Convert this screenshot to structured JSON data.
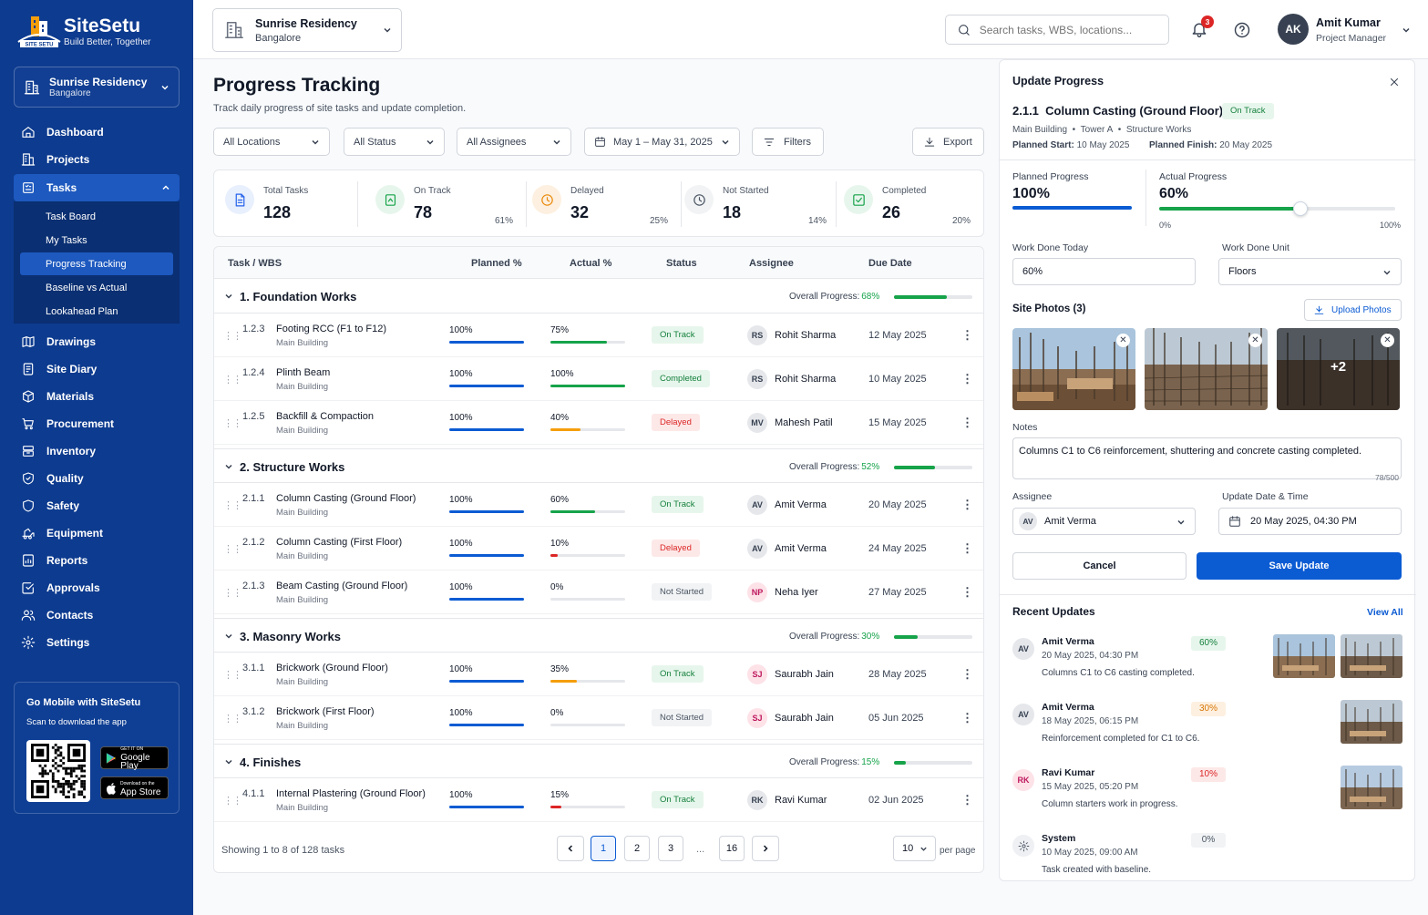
{
  "app": {
    "name": "SiteSetu",
    "tagline": "Build Better, Together",
    "logo_text": "SITE SETU"
  },
  "sidebar": {
    "project": {
      "name": "Sunrise Residency",
      "city": "Bangalore"
    },
    "items": [
      {
        "label": "Dashboard",
        "icon": "home-icon"
      },
      {
        "label": "Projects",
        "icon": "building-icon"
      },
      {
        "label": "Tasks",
        "icon": "tasks-icon",
        "expanded": true
      },
      {
        "label": "Drawings",
        "icon": "drawings-icon"
      },
      {
        "label": "Site Diary",
        "icon": "diary-icon"
      },
      {
        "label": "Materials",
        "icon": "box-icon"
      },
      {
        "label": "Procurement",
        "icon": "cart-icon"
      },
      {
        "label": "Inventory",
        "icon": "inventory-icon"
      },
      {
        "label": "Quality",
        "icon": "shield-icon"
      },
      {
        "label": "Safety",
        "icon": "safety-icon"
      },
      {
        "label": "Equipment",
        "icon": "equipment-icon"
      },
      {
        "label": "Reports",
        "icon": "reports-icon"
      },
      {
        "label": "Approvals",
        "icon": "approvals-icon"
      },
      {
        "label": "Contacts",
        "icon": "contacts-icon"
      },
      {
        "label": "Settings",
        "icon": "gear-icon"
      }
    ],
    "subitems": [
      "Task Board",
      "My Tasks",
      "Progress Tracking",
      "Baseline vs Actual",
      "Lookahead Plan"
    ],
    "active_subitem": "Progress Tracking",
    "mobile": {
      "title": "Go Mobile with SiteSetu",
      "subtitle": "Scan to download the app",
      "google_small": "GET IT ON",
      "google": "Google Play",
      "apple_small": "Download on the",
      "apple": "App Store"
    }
  },
  "header": {
    "project_name": "Sunrise Residency",
    "project_city": "Bangalore",
    "search_placeholder": "Search tasks, WBS, locations...",
    "notifications_count": "3",
    "user_initials": "AK",
    "user_name": "Amit Kumar",
    "user_role": "Project Manager"
  },
  "page": {
    "title": "Progress Tracking",
    "subtitle": "Track daily progress of site tasks and update completion.",
    "filters": {
      "location": "All Locations",
      "status": "All Status",
      "assignees": "All Assignees",
      "date_range": "May 1 – May 31, 2025",
      "filters_label": "Filters",
      "export_label": "Export"
    }
  },
  "kpis": [
    {
      "label": "Total Tasks",
      "value": "128",
      "pct": "",
      "color": "#2563eb",
      "bg": "#e8effd",
      "icon": "document-icon"
    },
    {
      "label": "On Track",
      "value": "78",
      "pct": "61%",
      "color": "#16a34a",
      "bg": "#e7f6ec",
      "icon": "progress-icon"
    },
    {
      "label": "Delayed",
      "value": "32",
      "pct": "25%",
      "color": "#ea8a0c",
      "bg": "#fdf0e0",
      "icon": "clock-icon"
    },
    {
      "label": "Not Started",
      "value": "18",
      "pct": "14%",
      "color": "#4b5563",
      "bg": "#f1f3f5",
      "icon": "clock-icon"
    },
    {
      "label": "Completed",
      "value": "26",
      "pct": "20%",
      "color": "#16a34a",
      "bg": "#e7f6ec",
      "icon": "check-icon"
    }
  ],
  "table": {
    "headers": {
      "task": "Task / WBS",
      "planned": "Planned %",
      "actual": "Actual %",
      "status": "Status",
      "assignee": "Assignee",
      "due": "Due Date"
    },
    "overall_label": "Overall Progress:",
    "groups": [
      {
        "title": "1. Foundation Works",
        "overall": "68%",
        "overall_value": 68,
        "tasks": [
          {
            "code": "1.2.3",
            "name": "Footing RCC (F1 to F12)",
            "location": "Main Building",
            "planned": "100%",
            "planned_value": 100,
            "actual": "75%",
            "actual_value": 75,
            "status": "On Track",
            "initials": "RS",
            "assignee": "Rohit Sharma",
            "due": "12 May 2025"
          },
          {
            "code": "1.2.4",
            "name": "Plinth Beam",
            "location": "Main Building",
            "planned": "100%",
            "planned_value": 100,
            "actual": "100%",
            "actual_value": 100,
            "status": "Completed",
            "initials": "RS",
            "assignee": "Rohit Sharma",
            "due": "10 May 2025"
          },
          {
            "code": "1.2.5",
            "name": "Backfill & Compaction",
            "location": "Main Building",
            "planned": "100%",
            "planned_value": 100,
            "actual": "40%",
            "actual_value": 40,
            "status": "Delayed",
            "initials": "MV",
            "assignee": "Mahesh Patil",
            "due": "15 May 2025"
          }
        ]
      },
      {
        "title": "2. Structure Works",
        "overall": "52%",
        "overall_value": 52,
        "tasks": [
          {
            "code": "2.1.1",
            "name": "Column Casting (Ground Floor)",
            "location": "Main Building",
            "planned": "100%",
            "planned_value": 100,
            "actual": "60%",
            "actual_value": 60,
            "status": "On Track",
            "initials": "AV",
            "assignee": "Amit Verma",
            "due": "20 May 2025"
          },
          {
            "code": "2.1.2",
            "name": "Column Casting (First Floor)",
            "location": "Main Building",
            "planned": "100%",
            "planned_value": 100,
            "actual": "10%",
            "actual_value": 10,
            "status": "Delayed",
            "initials": "AV",
            "assignee": "Amit Verma",
            "due": "24 May 2025"
          },
          {
            "code": "2.1.3",
            "name": "Beam Casting (Ground Floor)",
            "location": "Main Building",
            "planned": "100%",
            "planned_value": 100,
            "actual": "0%",
            "actual_value": 0,
            "status": "Not Started",
            "initials": "NP",
            "assignee": "Neha Iyer",
            "due": "27 May 2025"
          }
        ]
      },
      {
        "title": "3. Masonry Works",
        "overall": "30%",
        "overall_value": 30,
        "tasks": [
          {
            "code": "3.1.1",
            "name": "Brickwork (Ground Floor)",
            "location": "Main Building",
            "planned": "100%",
            "planned_value": 100,
            "actual": "35%",
            "actual_value": 35,
            "status": "On Track",
            "initials": "SJ",
            "assignee": "Saurabh Jain",
            "due": "28 May 2025"
          },
          {
            "code": "3.1.2",
            "name": "Brickwork (First Floor)",
            "location": "Main Building",
            "planned": "100%",
            "planned_value": 100,
            "actual": "0%",
            "actual_value": 0,
            "status": "Not Started",
            "initials": "SJ",
            "assignee": "Saurabh Jain",
            "due": "05 Jun 2025"
          }
        ]
      },
      {
        "title": "4. Finishes",
        "overall": "15%",
        "overall_value": 15,
        "tasks": [
          {
            "code": "4.1.1",
            "name": "Internal Plastering (Ground Floor)",
            "location": "Main Building",
            "planned": "100%",
            "planned_value": 100,
            "actual": "15%",
            "actual_value": 15,
            "status": "On Track",
            "initials": "RK",
            "assignee": "Ravi Kumar",
            "due": "02 Jun 2025"
          }
        ]
      }
    ],
    "showing": "Showing 1 to 8 of 128 tasks",
    "pages": [
      "1",
      "2",
      "3",
      "...",
      "16"
    ],
    "current_page": "1",
    "per_page": "10",
    "per_page_label": "per page"
  },
  "panel": {
    "title": "Update Progress",
    "task_code": "2.1.1",
    "task_name": "Column Casting (Ground Floor)",
    "status": "On Track",
    "breadcrumb": [
      "Main Building",
      "Tower A",
      "Structure Works"
    ],
    "planned_start_label": "Planned Start:",
    "planned_start": "10 May 2025",
    "planned_finish_label": "Planned Finish:",
    "planned_finish": "20 May 2025",
    "planned_label": "Planned Progress",
    "planned_value": "100%",
    "planned_fraction": 1.0,
    "actual_label": "Actual Progress",
    "actual_value": "60%",
    "actual_fraction": 0.6,
    "slider_min": "0%",
    "slider_max": "100%",
    "work_today_label": "Work Done Today",
    "work_today_value": "60%",
    "unit_label": "Work Done Unit",
    "unit_value": "Floors",
    "photos_label": "Site Photos (3)",
    "upload_label": "Upload Photos",
    "more_photos": "+2",
    "notes_label": "Notes",
    "notes_value": "Columns C1 to C6 reinforcement, shuttering and concrete casting completed.",
    "notes_count": "78/500",
    "assignee_label": "Assignee",
    "assignee_initials": "AV",
    "assignee_value": "Amit Verma",
    "datetime_label": "Update Date & Time",
    "datetime_value": "20 May 2025, 04:30 PM",
    "cancel_label": "Cancel",
    "save_label": "Save Update"
  },
  "recent": {
    "title": "Recent Updates",
    "view_all": "View All",
    "items": [
      {
        "initials": "AV",
        "name": "Amit Verma",
        "date": "20 May 2025, 04:30 PM",
        "note": "Columns C1 to C6 casting completed.",
        "pct": "60%",
        "images": 2
      },
      {
        "initials": "AV",
        "name": "Amit Verma",
        "date": "18 May 2025, 06:15 PM",
        "note": "Reinforcement completed for C1 to C6.",
        "pct": "30%",
        "images": 1
      },
      {
        "initials": "RK",
        "name": "Ravi Kumar",
        "date": "15 May 2025, 05:20 PM",
        "note": "Column starters work in progress.",
        "pct": "10%",
        "images": 1
      },
      {
        "initials": "",
        "name": "System",
        "date": "10 May 2025, 09:00 AM",
        "note": "Task created with baseline.",
        "pct": "0%",
        "images": 0
      }
    ]
  },
  "colors": {
    "primary": "#0d3b8f",
    "accent": "#0b5bd3",
    "success": "#16a34a",
    "warning": "#f59e0b",
    "danger": "#dc2626"
  }
}
